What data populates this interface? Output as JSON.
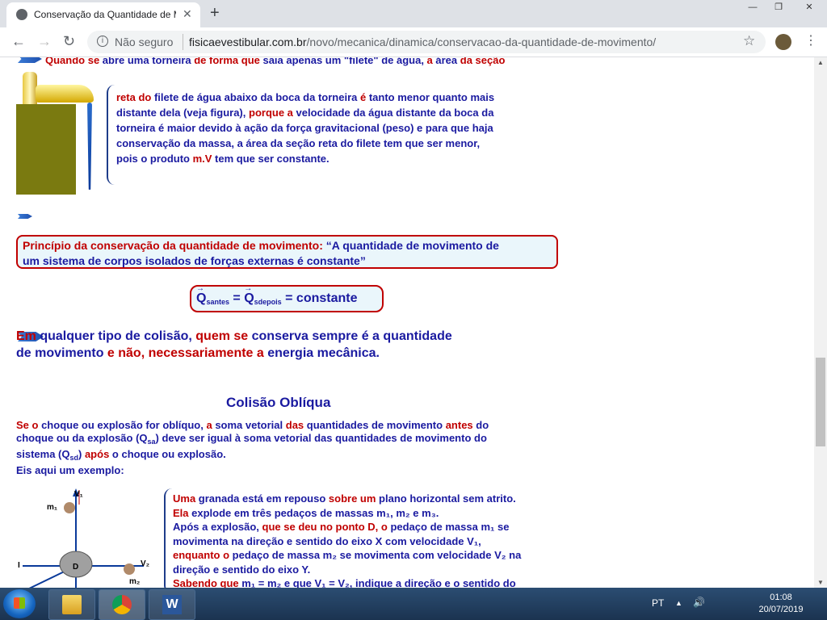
{
  "tab": {
    "title": "Conservação da Quantidade de M",
    "close": "✕",
    "new_tab": "+"
  },
  "window": {
    "minimize": "—",
    "maximize": "❐",
    "close": "✕"
  },
  "address": {
    "security": "Não seguro",
    "domain": "fisicaevestibular.com.br",
    "path": "/novo/mecanica/dinamica/conservacao-da-quantidade-de-movimento/"
  },
  "nav": {
    "back": "←",
    "forward": "→",
    "reload": "↻",
    "star": "☆",
    "menu": "⋮",
    "info": "i"
  },
  "page": {
    "line0": {
      "a": "Quando ",
      "b": "se",
      "c": " abre uma torneira ",
      "d": "de forma que",
      "e": " saia apenas um \"filete\" de água, ",
      "f": "a",
      "g": " área ",
      "h": "da seção"
    },
    "faucet_text": [
      [
        {
          "t": "reta do",
          "c": "red"
        },
        {
          "t": " filete de água  abaixo da boca da torneira ",
          "c": "blue"
        },
        {
          "t": "é",
          "c": "red"
        },
        {
          "t": " tanto  menor quanto mais",
          "c": "blue"
        }
      ],
      [
        {
          "t": "distante dela (veja figura), ",
          "c": "blue"
        },
        {
          "t": "porque a",
          "c": "red"
        },
        {
          "t": "  velocidade da água distante da boca  da",
          "c": "blue"
        }
      ],
      [
        {
          "t": "torneira é maior devido à ação da força gravitacional (peso) e   para que  haja",
          "c": "blue"
        }
      ],
      [
        {
          "t": " conservação da massa, a área da seção reta do filete tem que ser menor,",
          "c": "blue"
        }
      ],
      [
        {
          "t": "pois o  produto ",
          "c": "blue"
        },
        {
          "t": "m.V",
          "c": "red"
        },
        {
          "t": " tem que ser constante.",
          "c": "blue"
        }
      ]
    ],
    "principle": {
      "label": "Princípio da conservação da quantidade de movimento:",
      "text1": " “A quantidade de movimento de",
      "text2": "um sistema de corpos isolados de forças externas é constante”"
    },
    "formula": {
      "q1": "Q",
      "sub1": "santes",
      "eq1": " = ",
      "q2": "Q",
      "sub2": "sdepois",
      "eq2": " = constante"
    },
    "collision": [
      [
        {
          "t": "Em",
          "c": "red"
        },
        {
          "t": " qualquer tipo de colisão, ",
          "c": "blue"
        },
        {
          "t": "quem se",
          "c": "red"
        },
        {
          "t": " conserva sempre é a quantidade",
          "c": "blue"
        }
      ],
      [
        {
          "t": "de movimento ",
          "c": "blue"
        },
        {
          "t": "e não, necessariamente a",
          "c": "red"
        },
        {
          "t": " energia mecânica.",
          "c": "blue"
        }
      ]
    ],
    "oblique_title": "Colisão Oblíqua",
    "oblique_text": [
      [
        {
          "t": "Se o",
          "c": "red"
        },
        {
          "t": " choque ou explosão for oblíquo, ",
          "c": "blue"
        },
        {
          "t": "a",
          "c": "red"
        },
        {
          "t": " soma vetorial ",
          "c": "blue"
        },
        {
          "t": "das",
          "c": "red"
        },
        {
          "t": " quantidades de movimento ",
          "c": "blue"
        },
        {
          "t": "antes",
          "c": "red"
        },
        {
          "t": " do",
          "c": "blue"
        }
      ],
      [
        {
          "t": "choque ou da explosão (Q",
          "c": "blue"
        },
        {
          "t": "sa",
          "c": "sub"
        },
        {
          "t": ") deve ser igual à soma vetorial das quantidades de movimento do",
          "c": "blue"
        }
      ],
      [
        {
          "t": "sistema (Q",
          "c": "blue"
        },
        {
          "t": "sd",
          "c": "sub"
        },
        {
          "t": ") ",
          "c": "blue"
        },
        {
          "t": "após",
          "c": "red"
        },
        {
          "t": " o choque ou  explosão.",
          "c": "blue"
        }
      ],
      [
        {
          "t": " Eis aqui um exemplo:",
          "c": "blue"
        }
      ]
    ],
    "grenade_text": [
      [
        {
          "t": "Uma",
          "c": "red"
        },
        {
          "t": " granada está em repouso ",
          "c": "blue"
        },
        {
          "t": "sobre um",
          "c": "red"
        },
        {
          "t": " plano horizontal sem atrito.",
          "c": "blue"
        }
      ],
      [
        {
          "t": "Ela",
          "c": "red"
        },
        {
          "t": " explode em três pedaços de  massas m₁, m₂ e m₃.",
          "c": "blue"
        }
      ],
      [
        {
          "t": "Após a explosão, ",
          "c": "blue"
        },
        {
          "t": "que se deu no ponto D, o",
          "c": "red"
        },
        {
          "t": " pedaço de massa m₁ se",
          "c": "blue"
        }
      ],
      [
        {
          "t": "movimenta na direção e sentido do eixo X com velocidade V₁,",
          "c": "blue"
        }
      ],
      [
        {
          "t": "enquanto o",
          "c": "red"
        },
        {
          "t": " pedaço de massa m₂ se movimenta com  velocidade V₂ na",
          "c": "blue"
        }
      ],
      [
        {
          "t": "direção e sentido do eixo Y.",
          "c": "blue"
        }
      ],
      [
        {
          "t": "Sabendo que",
          "c": "red"
        },
        {
          "t": " m₁ = m₂ e que V₁ = V₂, indique  a direção e o sentido do",
          "c": "blue"
        }
      ]
    ],
    "diagram": {
      "v1": "V₁",
      "m1": "m₁",
      "v2": "V₂",
      "m2": "m₂",
      "d": "D",
      "axis": "I"
    }
  },
  "taskbar": {
    "lang": "PT",
    "time": "01:08",
    "date": "20/07/2019",
    "tray_up": "▲",
    "speaker": "🔊"
  },
  "colors": {
    "red": "#c00000",
    "blue": "#1a1aa0"
  }
}
